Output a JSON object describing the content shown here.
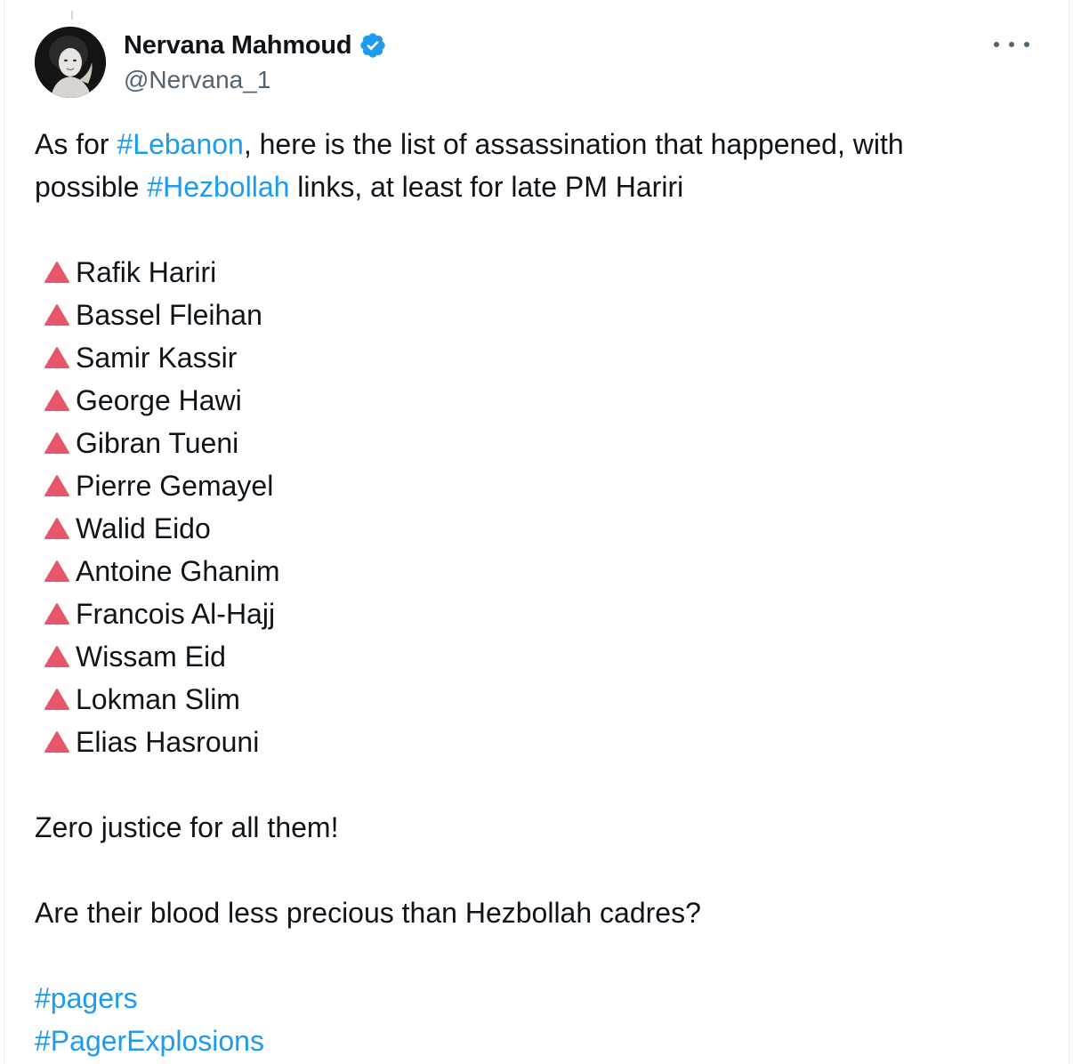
{
  "author": {
    "display_name": "Nervana Mahmoud",
    "handle": "@Nervana_1",
    "verified": true
  },
  "icons": {
    "verified": "verified-badge-icon",
    "more": "more-options-icon",
    "bullet": "red-triangle-up-icon"
  },
  "colors": {
    "link": "#1d9bf0",
    "verified": "#1d9bf0",
    "bullet": "#e8566b",
    "text": "#0f1419",
    "secondary": "#536471"
  },
  "tweet": {
    "intro": {
      "part1": "As for ",
      "hashtag1": "#Lebanon",
      "part2": ", here is the list of assassination that happened, with",
      "part3": "possible ",
      "hashtag2": "#Hezbollah",
      "part4": " links, at least for late PM Hariri"
    },
    "names": [
      "Rafik Hariri",
      "Bassel Fleihan",
      "Samir Kassir",
      "George Hawi",
      "Gibran Tueni",
      "Pierre Gemayel",
      "Walid Eido",
      "Antoine Ghanim",
      "Francois Al-Hajj",
      "Wissam Eid",
      "Lokman Slim",
      "Elias Hasrouni"
    ],
    "line_justice": "Zero justice for all them!",
    "line_question": "Are their blood less precious than Hezbollah cadres?",
    "hashtags_end": [
      "#pagers",
      "#PagerExplosions"
    ]
  }
}
